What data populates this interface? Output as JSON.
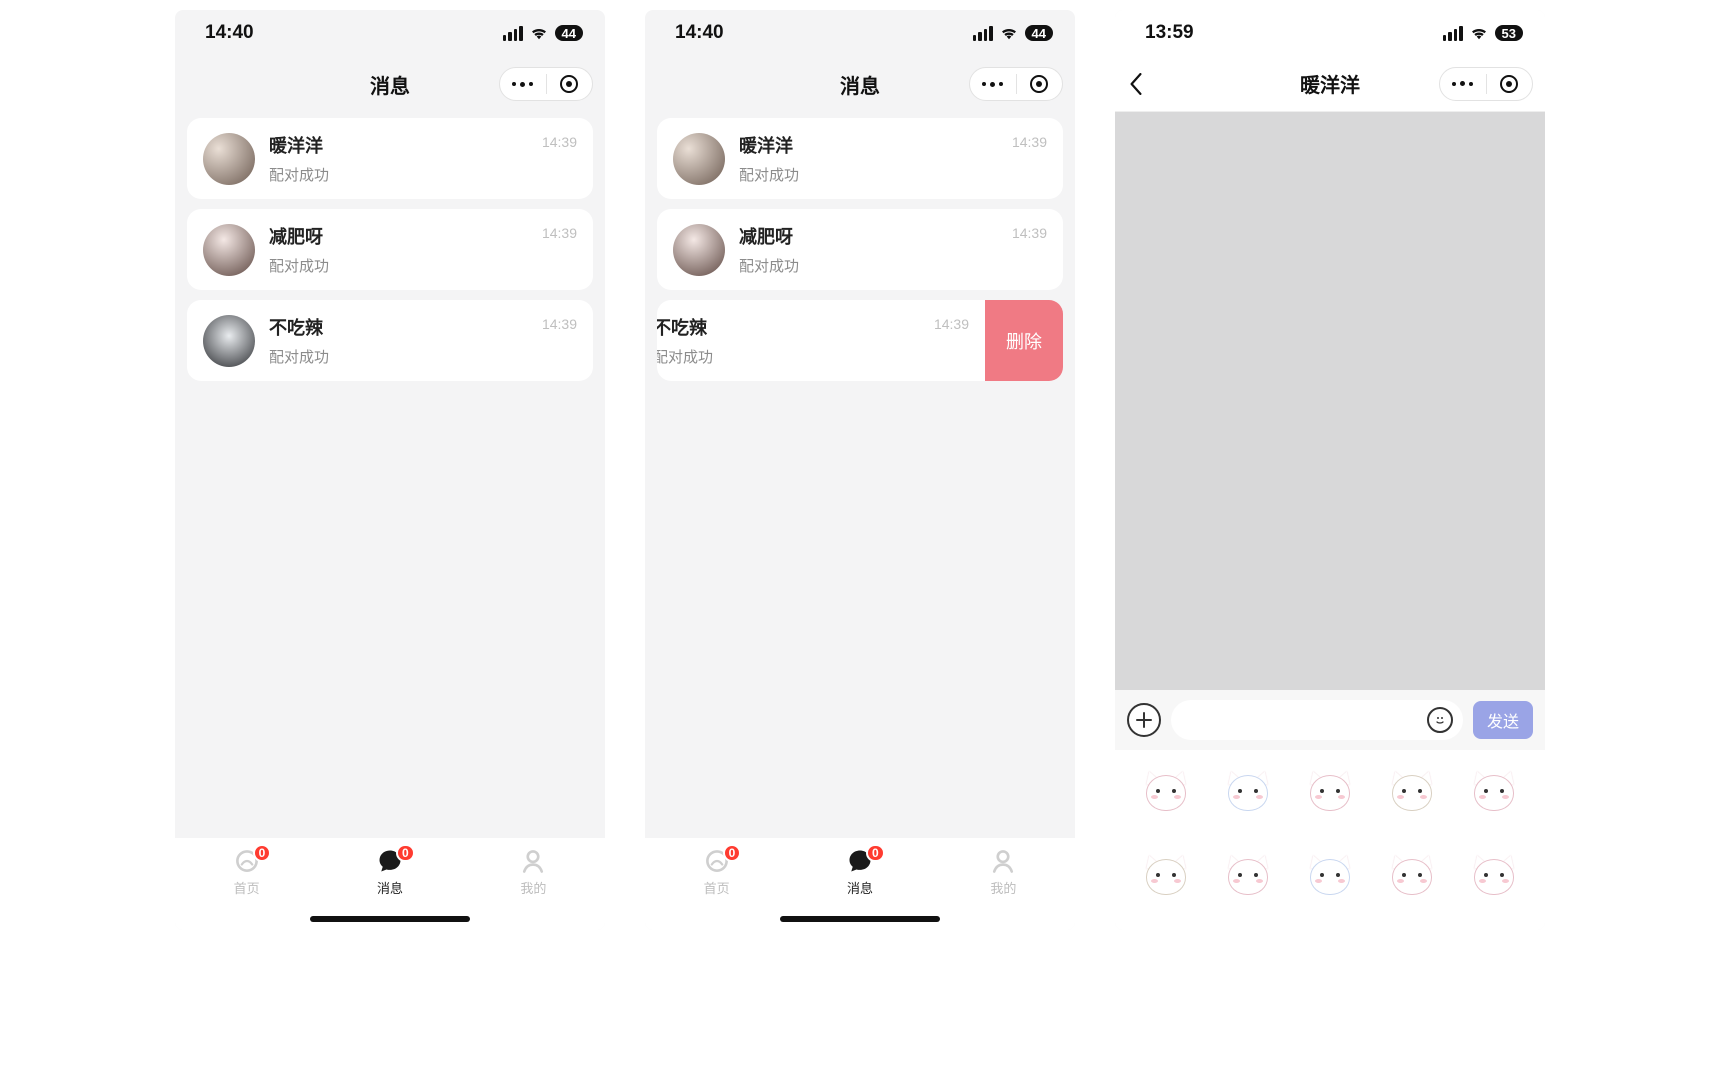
{
  "screen_a": {
    "time": "14:40",
    "battery": "44",
    "title": "消息",
    "items": [
      {
        "name": "暖洋洋",
        "sub": "配对成功",
        "ts": "14:39"
      },
      {
        "name": "减肥呀",
        "sub": "配对成功",
        "ts": "14:39"
      },
      {
        "name": "不吃辣",
        "sub": "配对成功",
        "ts": "14:39"
      }
    ],
    "tabs": {
      "home": "首页",
      "msg": "消息",
      "me": "我的",
      "badge": "0"
    }
  },
  "screen_b": {
    "time": "14:40",
    "battery": "44",
    "title": "消息",
    "items": [
      {
        "name": "暖洋洋",
        "sub": "配对成功",
        "ts": "14:39"
      },
      {
        "name": "减肥呀",
        "sub": "配对成功",
        "ts": "14:39"
      },
      {
        "name": "不吃辣",
        "sub": "配对成功",
        "ts": "14:39"
      }
    ],
    "delete_label": "删除",
    "tabs": {
      "home": "首页",
      "msg": "消息",
      "me": "我的",
      "badge": "0"
    }
  },
  "screen_c": {
    "time": "13:59",
    "battery": "53",
    "title": "暖洋洋",
    "send_label": "发送",
    "input_placeholder": ""
  }
}
